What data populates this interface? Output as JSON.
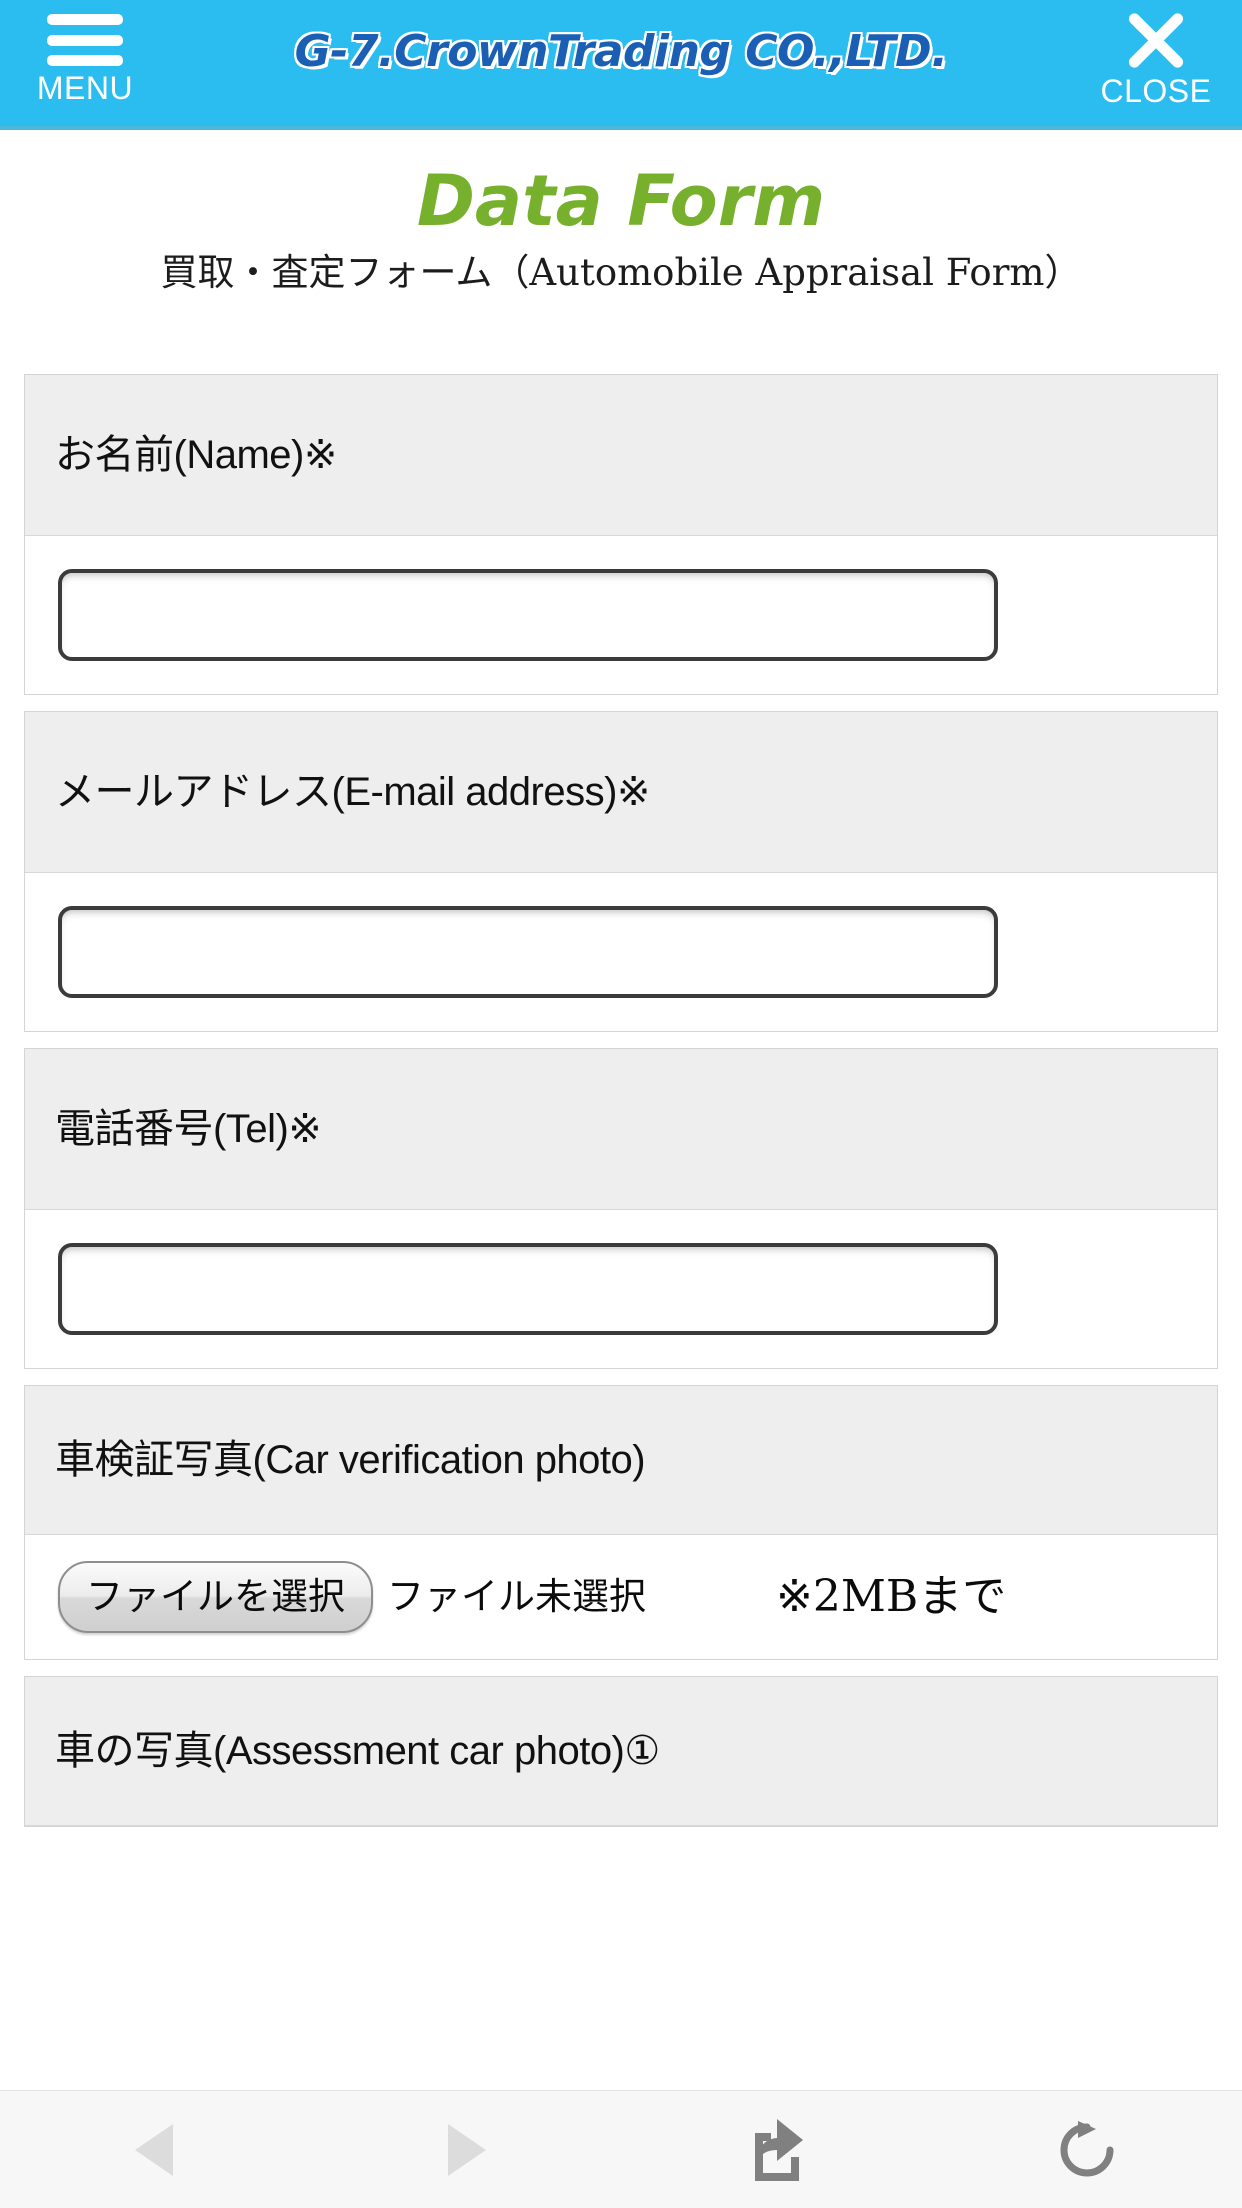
{
  "header": {
    "menu_label": "MENU",
    "menu_icon": "hamburger-menu-icon",
    "logo_text": "G-7.CrownTrading CO.,LTD.",
    "close_label": "CLOSE",
    "close_icon": "close-x-icon",
    "background_color": "#2bbdf0",
    "logo_color": "#1a5fb4"
  },
  "page": {
    "title": "Data Form",
    "title_color": "#76b02c",
    "subtitle": "買取・査定フォーム（Automobile Appraisal Form）"
  },
  "form": {
    "fields": [
      {
        "id": "name",
        "label": "お名前(Name)※",
        "type": "text",
        "value": "",
        "placeholder": ""
      },
      {
        "id": "email",
        "label": "メールアドレス(E-mail address)※",
        "type": "text",
        "value": "",
        "placeholder": ""
      },
      {
        "id": "tel",
        "label": "電話番号(Tel)※",
        "type": "text",
        "value": "",
        "placeholder": ""
      },
      {
        "id": "car_verification_photo",
        "label": "車検証写真(Car verification photo)",
        "type": "file",
        "button_label": "ファイルを選択",
        "status_text": "ファイル未選択",
        "note": "※2MBまで"
      },
      {
        "id": "assessment_car_photo_1",
        "label": "車の写真(Assessment car photo)①",
        "type": "file"
      }
    ]
  },
  "toolbar": {
    "buttons": [
      {
        "name": "back-button",
        "icon": "triangle-left-icon",
        "enabled": false,
        "color": "#dcdcdc"
      },
      {
        "name": "forward-button",
        "icon": "triangle-right-icon",
        "enabled": false,
        "color": "#dcdcdc"
      },
      {
        "name": "share-button",
        "icon": "share-icon",
        "enabled": true,
        "color": "#808080"
      },
      {
        "name": "reload-button",
        "icon": "reload-icon",
        "enabled": true,
        "color": "#808080"
      }
    ]
  }
}
